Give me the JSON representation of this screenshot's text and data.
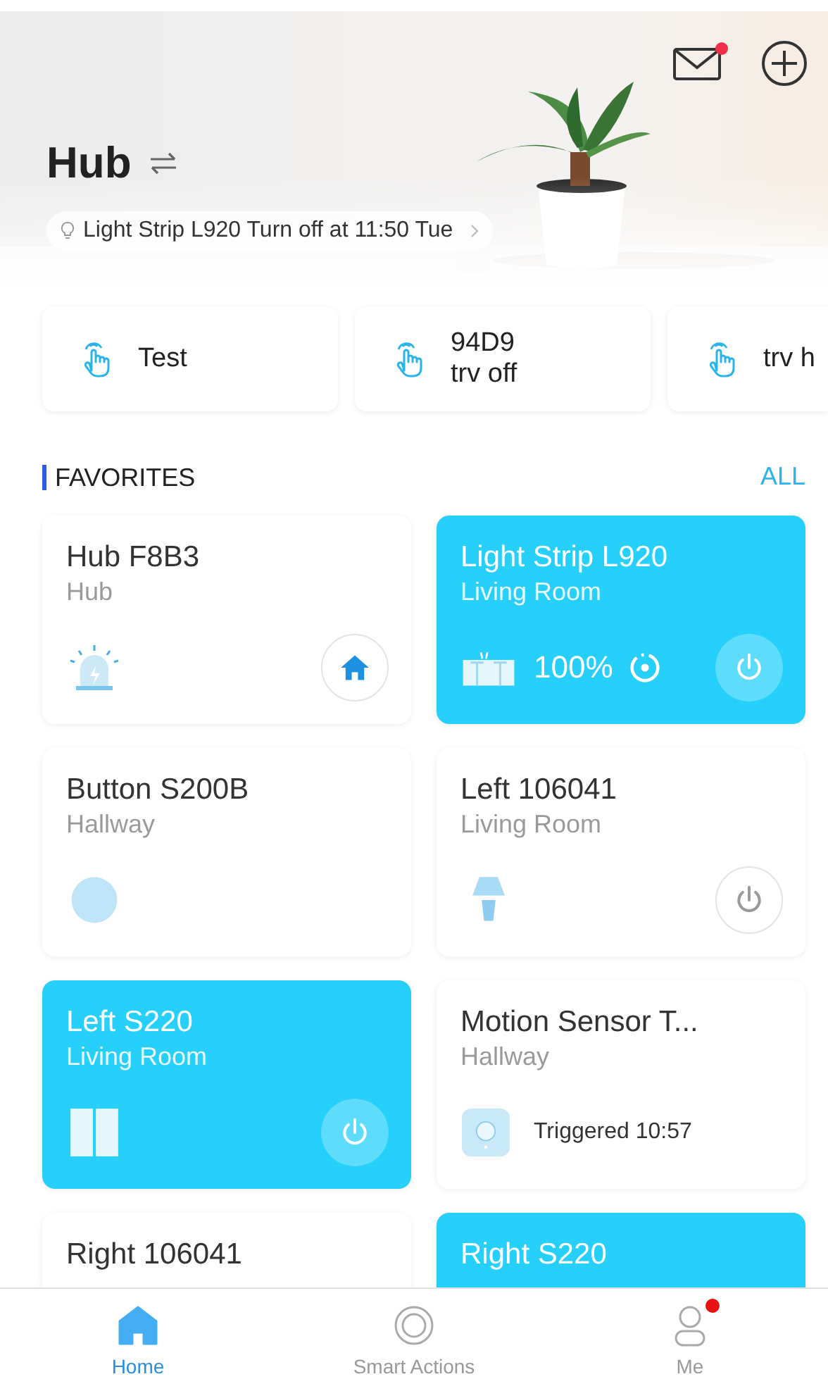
{
  "header": {
    "title": "Hub",
    "mail_unread": true,
    "reminder": "Light Strip L920 Turn off at 11:50 Tue"
  },
  "scenes": [
    {
      "lines": [
        "Test"
      ]
    },
    {
      "lines": [
        "94D9",
        "trv off"
      ]
    },
    {
      "lines": [
        "trv h"
      ]
    }
  ],
  "favorites": {
    "title": "FAVORITES",
    "all_link": "ALL",
    "devices": [
      {
        "name": "Hub F8B3",
        "room": "Hub",
        "kind": "hub",
        "on": false
      },
      {
        "name": "Light Strip L920",
        "room": "Living Room",
        "kind": "strip",
        "on": true,
        "reading": "100%"
      },
      {
        "name": "Button S200B",
        "room": "Hallway",
        "kind": "button",
        "on": false
      },
      {
        "name": "Left 106041",
        "room": "Living Room",
        "kind": "plug",
        "on": false
      },
      {
        "name": "Left S220",
        "room": "Living Room",
        "kind": "switch",
        "on": true
      },
      {
        "name": "Motion Sensor T...",
        "room": "Hallway",
        "kind": "sensor",
        "on": false,
        "status": "Triggered 10:57"
      },
      {
        "name": "Right 106041",
        "kind": "partial",
        "on": false
      },
      {
        "name": "Right S220",
        "kind": "partial",
        "on": true
      }
    ]
  },
  "tab_bar": [
    {
      "label": "Home",
      "kind": "home",
      "selected": true,
      "badge": false
    },
    {
      "label": "Smart Actions",
      "kind": "actions",
      "selected": false,
      "badge": false
    },
    {
      "label": "Me",
      "kind": "me",
      "selected": false,
      "badge": true
    }
  ]
}
